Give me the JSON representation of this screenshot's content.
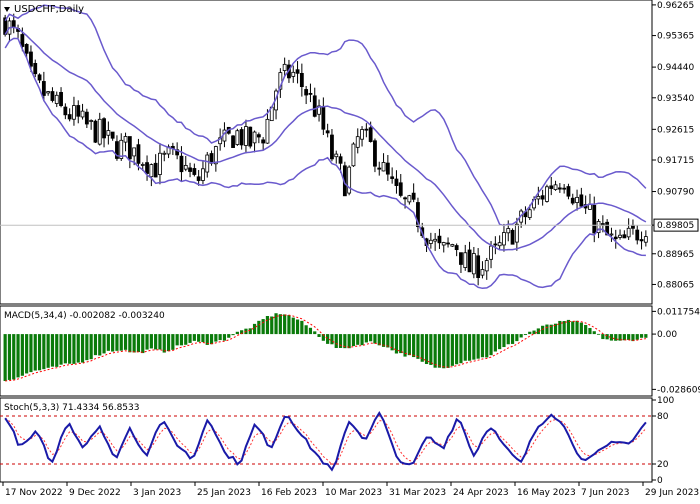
{
  "window": {
    "title": "USDCHF,Daily",
    "menu_icon": "triangle-down-icon"
  },
  "colors": {
    "background": "#ffffff",
    "frame": "#000000",
    "candle_up": "#ffffff",
    "candle_down": "#000000",
    "bollinger": "#6a5acd",
    "macd_histogram": "#0a7a0a",
    "macd_signal": "#ff0000",
    "stoch_main": "#1a1aa8",
    "stoch_signal": "#ff3333",
    "level_line": "#cc0000",
    "current_price_label_bg": "#ffffff"
  },
  "chart_data": [
    {
      "type": "candlestick",
      "title": "USDCHF,Daily",
      "symbol": "USDCHF",
      "timeframe": "Daily",
      "current_price": 0.898,
      "current_price_label": "0.89805",
      "ylim": [
        0.8755,
        0.9635
      ],
      "y_ticks": [
        "0.96265",
        "0.95365",
        "0.94440",
        "0.93540",
        "0.92615",
        "0.91715",
        "0.90790",
        "0.89805",
        "0.88965",
        "0.88065"
      ],
      "x_ticks": [
        "17 Nov 2022",
        "9 Dec 2022",
        "3 Jan 2023",
        "25 Jan 2023",
        "16 Feb 2023",
        "10 Mar 2023",
        "31 Mar 2023",
        "24 Apr 2023",
        "16 May 2023",
        "7 Jun 2023",
        "29 Jun 2023"
      ],
      "indicators": [
        "Bollinger Bands"
      ],
      "close_path": [
        0.958,
        0.952,
        0.94,
        0.936,
        0.932,
        0.93,
        0.927,
        0.925,
        0.921,
        0.921,
        0.918,
        0.915,
        0.918,
        0.916,
        0.91,
        0.918,
        0.922,
        0.925,
        0.922,
        0.925,
        0.94,
        0.943,
        0.938,
        0.93,
        0.918,
        0.91,
        0.925,
        0.92,
        0.912,
        0.905,
        0.902,
        0.895,
        0.89,
        0.893,
        0.885,
        0.887,
        0.89,
        0.895,
        0.9,
        0.905,
        0.91,
        0.912,
        0.905,
        0.9,
        0.895,
        0.892,
        0.895,
        0.898
      ]
    },
    {
      "type": "bar",
      "title": "MACD(5,34,4) -0.002082 -0.003240",
      "series_names": [
        "MACD",
        "Signal"
      ],
      "ylim": [
        -0.031,
        0.0135
      ],
      "y_ticks": [
        "0.011754",
        "0.00",
        "-0.028609"
      ],
      "values_path": [
        -0.024,
        -0.022,
        -0.019,
        -0.018,
        -0.016,
        -0.015,
        -0.012,
        -0.009,
        -0.008,
        -0.01,
        -0.008,
        -0.009,
        -0.006,
        -0.004,
        -0.005,
        -0.003,
        0.001,
        0.004,
        0.009,
        0.011,
        0.008,
        0.003,
        -0.004,
        -0.008,
        -0.006,
        -0.004,
        -0.006,
        -0.01,
        -0.012,
        -0.016,
        -0.018,
        -0.015,
        -0.013,
        -0.012,
        -0.008,
        -0.004,
        0.001,
        0.004,
        0.006,
        0.007,
        0.004,
        -0.002,
        -0.004,
        -0.003,
        -0.002
      ]
    },
    {
      "type": "line",
      "title": "Stoch(5,3,3) 71.4334 56.8533",
      "series_names": [
        "Main",
        "Signal"
      ],
      "ylim": [
        0,
        100
      ],
      "y_ticks": [
        "100",
        "80",
        "20",
        "0"
      ],
      "levels": [
        80,
        20
      ],
      "main_path": [
        80,
        40,
        60,
        20,
        75,
        40,
        70,
        25,
        65,
        30,
        75,
        45,
        25,
        80,
        35,
        20,
        70,
        40,
        85,
        55,
        30,
        10,
        75,
        50,
        85,
        30,
        15,
        55,
        40,
        80,
        30,
        70,
        40,
        20,
        65,
        85,
        60,
        20,
        35,
        50,
        45,
        72
      ]
    }
  ]
}
